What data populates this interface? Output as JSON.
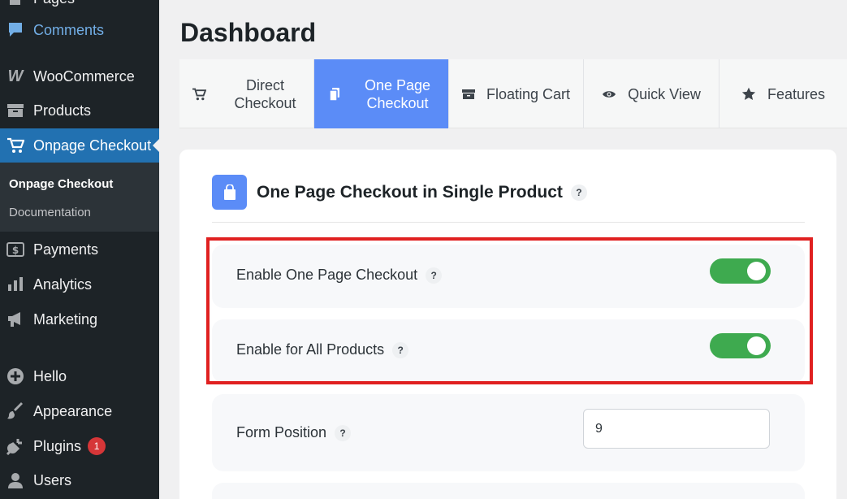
{
  "sidebar": {
    "top_partial": "Pages",
    "comments": "Comments",
    "woocommerce": "WooCommerce",
    "products": "Products",
    "onpage_checkout": "Onpage Checkout",
    "submenu": [
      "Onpage Checkout",
      "Documentation"
    ],
    "payments": "Payments",
    "analytics": "Analytics",
    "marketing": "Marketing",
    "hello": "Hello",
    "appearance": "Appearance",
    "plugins": "Plugins",
    "plugins_badge": "1",
    "users": "Users"
  },
  "page": {
    "title": "Dashboard"
  },
  "tabs": [
    {
      "label": "Direct Checkout",
      "icon": "cart-icon"
    },
    {
      "label": "One Page Checkout",
      "icon": "copy-icon"
    },
    {
      "label": "Floating Cart",
      "icon": "box-icon"
    },
    {
      "label": "Quick View",
      "icon": "eye-icon"
    },
    {
      "label": "Features",
      "icon": "star-icon"
    }
  ],
  "card": {
    "title": "One Page Checkout in Single Product",
    "help": "?",
    "settings": [
      {
        "label": "Enable One Page Checkout",
        "help": "?",
        "type": "toggle",
        "enabled": true
      },
      {
        "label": "Enable for All Products",
        "help": "?",
        "type": "toggle",
        "enabled": true
      },
      {
        "label": "Form Position",
        "help": "?",
        "type": "number",
        "value": "9"
      }
    ]
  },
  "colors": {
    "sidebar_bg": "#1d2327",
    "wp_accent": "#2271b1",
    "tab_active": "#5b8cf7",
    "toggle_on": "#3eaa4f",
    "highlight": "#e02020",
    "badge": "#d63638"
  }
}
